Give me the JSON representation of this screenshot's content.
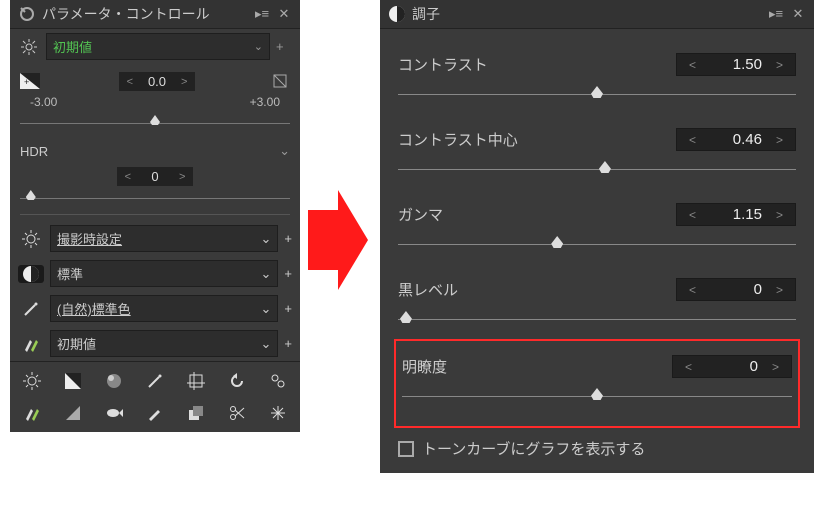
{
  "left_panel": {
    "title": "パラメータ・コントロール",
    "top_row": {
      "value": "初期値",
      "plus": "+"
    },
    "exposure": {
      "value": "0.0",
      "min_label": "-3.00",
      "max_label": "+3.00",
      "thumb_pct": 50
    },
    "hdr": {
      "label": "HDR",
      "value": "0",
      "thumb_pct": 4
    },
    "presets": [
      {
        "icon": "sun-icon",
        "label": "撮影時設定",
        "active": false,
        "underline": true
      },
      {
        "icon": "contrast-icon",
        "label": "標準",
        "active": true,
        "underline": false
      },
      {
        "icon": "wand-icon",
        "label": "(自然)標準色",
        "active": false,
        "underline": true
      },
      {
        "icon": "brushes-icon",
        "label": "初期値",
        "active": false,
        "underline": false
      }
    ],
    "grid_icons": [
      "sun-icon",
      "levels-icon",
      "sphere-icon",
      "wand-icon",
      "crop-icon",
      "undo-icon",
      "gears-icon",
      "brushes-icon",
      "triangle-icon",
      "fish-icon",
      "brush-icon",
      "layers-icon",
      "scissors-icon",
      "sparkle-icon"
    ]
  },
  "right_panel": {
    "title": "調子",
    "params": [
      {
        "key": "contrast",
        "label": "コントラスト",
        "value": "1.50",
        "thumb_pct": 50
      },
      {
        "key": "contrast_center",
        "label": "コントラスト中心",
        "value": "0.46",
        "thumb_pct": 52
      },
      {
        "key": "gamma",
        "label": "ガンマ",
        "value": "1.15",
        "thumb_pct": 40
      },
      {
        "key": "black_level",
        "label": "黒レベル",
        "value": "0",
        "thumb_pct": 2
      }
    ],
    "highlight_param": {
      "key": "clarity",
      "label": "明瞭度",
      "value": "0",
      "thumb_pct": 50
    },
    "checkbox_label": "トーンカーブにグラフを表示する"
  },
  "chart_data": {
    "type": "table",
    "title": "調子 (Tone) parameters",
    "series": [
      {
        "name": "コントラスト",
        "value": 1.5
      },
      {
        "name": "コントラスト中心",
        "value": 0.46
      },
      {
        "name": "ガンマ",
        "value": 1.15
      },
      {
        "name": "黒レベル",
        "value": 0
      },
      {
        "name": "明瞭度",
        "value": 0
      }
    ]
  }
}
